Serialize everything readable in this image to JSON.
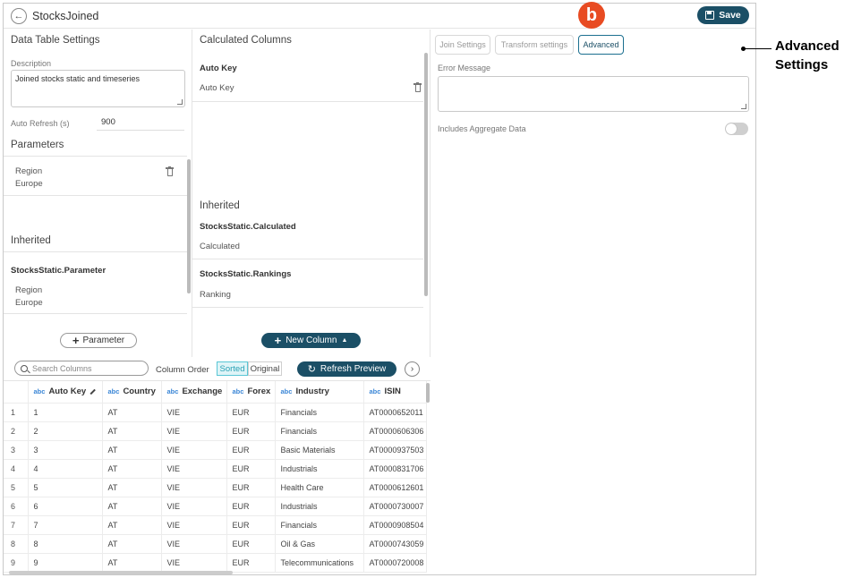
{
  "header": {
    "title": "StocksJoined",
    "save_label": "Save"
  },
  "callout": {
    "badge_letter": "b",
    "annotation_line1": "Advanced",
    "annotation_line2": "Settings",
    "badge_color": "#e84b22"
  },
  "left_panel": {
    "title": "Data Table Settings",
    "description_label": "Description",
    "description_value": "Joined stocks static and timeseries",
    "auto_refresh_label": "Auto Refresh (s)",
    "auto_refresh_value": "900",
    "parameters_title": "Parameters",
    "parameter": {
      "name": "Region",
      "value": "Europe"
    },
    "inherited_title": "Inherited",
    "inherited_source": "StocksStatic.Parameter",
    "inherited_param": {
      "name": "Region",
      "value": "Europe"
    },
    "add_button": "Parameter"
  },
  "mid_panel": {
    "title": "Calculated Columns",
    "column_heading": "Auto Key",
    "column_value": "Auto Key",
    "inherited_title": "Inherited",
    "inherited_1_heading": "StocksStatic.Calculated",
    "inherited_1_value": "Calculated",
    "inherited_2_heading": "StocksStatic.Rankings",
    "inherited_2_value": "Ranking",
    "new_column_button": "New Column"
  },
  "right_panel": {
    "tabs": [
      {
        "label": "Join Settings",
        "active": false
      },
      {
        "label": "Transform settings",
        "active": false
      },
      {
        "label": "Advanced",
        "active": true
      }
    ],
    "error_message_label": "Error Message",
    "error_message_value": "",
    "aggregate_label": "Includes Aggregate Data",
    "aggregate_enabled": false
  },
  "toolbar": {
    "search_placeholder": "Search Columns",
    "column_order_label": "Column Order",
    "sorted_label": "Sorted",
    "original_label": "Original",
    "refresh_label": "Refresh Preview"
  },
  "table": {
    "type_tag": "abc",
    "columns": [
      "Auto Key",
      "Country",
      "Exchange",
      "Forex",
      "Industry",
      "ISIN"
    ],
    "rows": [
      [
        "1",
        "1",
        "AT",
        "VIE",
        "EUR",
        "Financials",
        "AT0000652011"
      ],
      [
        "2",
        "2",
        "AT",
        "VIE",
        "EUR",
        "Financials",
        "AT0000606306"
      ],
      [
        "3",
        "3",
        "AT",
        "VIE",
        "EUR",
        "Basic Materials",
        "AT0000937503"
      ],
      [
        "4",
        "4",
        "AT",
        "VIE",
        "EUR",
        "Industrials",
        "AT0000831706"
      ],
      [
        "5",
        "5",
        "AT",
        "VIE",
        "EUR",
        "Health Care",
        "AT0000612601"
      ],
      [
        "6",
        "6",
        "AT",
        "VIE",
        "EUR",
        "Industrials",
        "AT0000730007"
      ],
      [
        "7",
        "7",
        "AT",
        "VIE",
        "EUR",
        "Financials",
        "AT0000908504"
      ],
      [
        "8",
        "8",
        "AT",
        "VIE",
        "EUR",
        "Oil & Gas",
        "AT0000743059"
      ],
      [
        "9",
        "9",
        "AT",
        "VIE",
        "EUR",
        "Telecommunications",
        "AT0000720008"
      ]
    ]
  }
}
